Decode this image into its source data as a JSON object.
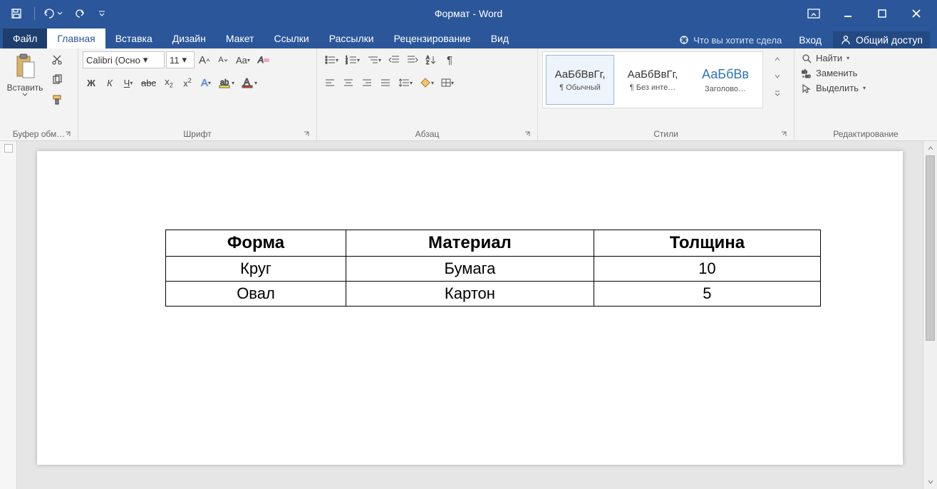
{
  "title": "Формат - Word",
  "tabs": {
    "file": "Файл",
    "home": "Главная",
    "insert": "Вставка",
    "design": "Дизайн",
    "layout": "Макет",
    "references": "Ссылки",
    "mailings": "Рассылки",
    "review": "Рецензирование",
    "view": "Вид"
  },
  "tellme_placeholder": "Что вы хотите сдела",
  "signin": "Вход",
  "share": "Общий доступ",
  "clipboard": {
    "paste": "Вставить",
    "group": "Буфер обм…"
  },
  "font": {
    "name": "Calibri (Осно",
    "size": "11",
    "group": "Шрифт"
  },
  "paragraph": {
    "group": "Абзац"
  },
  "styles": {
    "group": "Стили",
    "items": [
      {
        "preview": "АаБбВвГг,",
        "label": "¶ Обычный"
      },
      {
        "preview": "АаБбВвГг,",
        "label": "¶ Без инте…"
      },
      {
        "preview": "АаБбВв",
        "label": "Заголово…"
      }
    ]
  },
  "editing": {
    "group": "Редактирование",
    "find": "Найти",
    "replace": "Заменить",
    "select": "Выделить"
  },
  "document": {
    "headers": [
      "Форма",
      "Материал",
      "Толщина"
    ],
    "rows": [
      [
        "Круг",
        "Бумага",
        "10"
      ],
      [
        "Овал",
        "Картон",
        "5"
      ]
    ]
  }
}
